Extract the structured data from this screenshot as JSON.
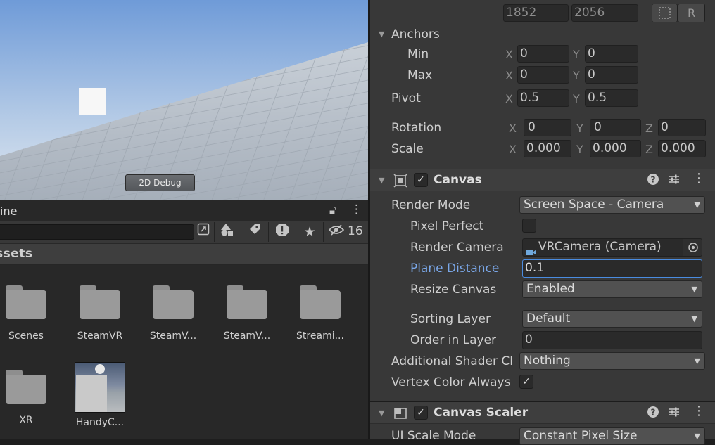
{
  "scene": {
    "debug_button": "2D Debug"
  },
  "project": {
    "title_fragment": "ine",
    "hidden_count": "16",
    "breadcrumb": "ssets",
    "items": [
      {
        "label": "Scenes",
        "kind": "folder"
      },
      {
        "label": "SteamVR",
        "kind": "folder"
      },
      {
        "label": "SteamV...",
        "kind": "folder"
      },
      {
        "label": "SteamV...",
        "kind": "folder"
      },
      {
        "label": "Streami...",
        "kind": "folder"
      },
      {
        "label": "XR",
        "kind": "folder"
      },
      {
        "label": "HandyC...",
        "kind": "prefab"
      }
    ],
    "toolbar_icons": [
      "maximize-icon",
      "filter-by-type-icon",
      "filter-by-label-icon",
      "warning-icon",
      "favorite-star-icon",
      "hidden-packages-icon"
    ]
  },
  "inspector": {
    "size_values": {
      "w": "1852",
      "h": "2056"
    },
    "anchors": {
      "label": "Anchors",
      "min_label": "Min",
      "min_x": "0",
      "min_y": "0",
      "max_label": "Max",
      "max_x": "0",
      "max_y": "0"
    },
    "pivot": {
      "label": "Pivot",
      "x": "0.5",
      "y": "0.5"
    },
    "rotation": {
      "label": "Rotation",
      "x": "0",
      "y": "0",
      "z": "0"
    },
    "scale": {
      "label": "Scale",
      "x": "0.000",
      "y": "0.000",
      "z": "0.000"
    },
    "axes": {
      "x": "X",
      "y": "Y",
      "z": "Z"
    },
    "canvas": {
      "title": "Canvas",
      "render_mode_label": "Render Mode",
      "render_mode_value": "Screen Space - Camera",
      "pixel_perfect_label": "Pixel Perfect",
      "render_camera_label": "Render Camera",
      "render_camera_value": "VRCamera (Camera)",
      "plane_distance_label": "Plane Distance",
      "plane_distance_value": "0.1",
      "resize_canvas_label": "Resize Canvas",
      "resize_canvas_value": "Enabled",
      "sorting_layer_label": "Sorting Layer",
      "sorting_layer_value": "Default",
      "order_label": "Order in Layer",
      "order_value": "0",
      "shader_label": "Additional Shader Cl",
      "shader_value": "Nothing",
      "vertex_label": "Vertex Color Always",
      "vertex_checked": "✓"
    },
    "canvas_scaler": {
      "title": "Canvas Scaler",
      "ui_scale_label": "UI Scale Mode",
      "ui_scale_value": "Constant Pixel Size"
    },
    "accent_color": "#7aa7e8"
  }
}
